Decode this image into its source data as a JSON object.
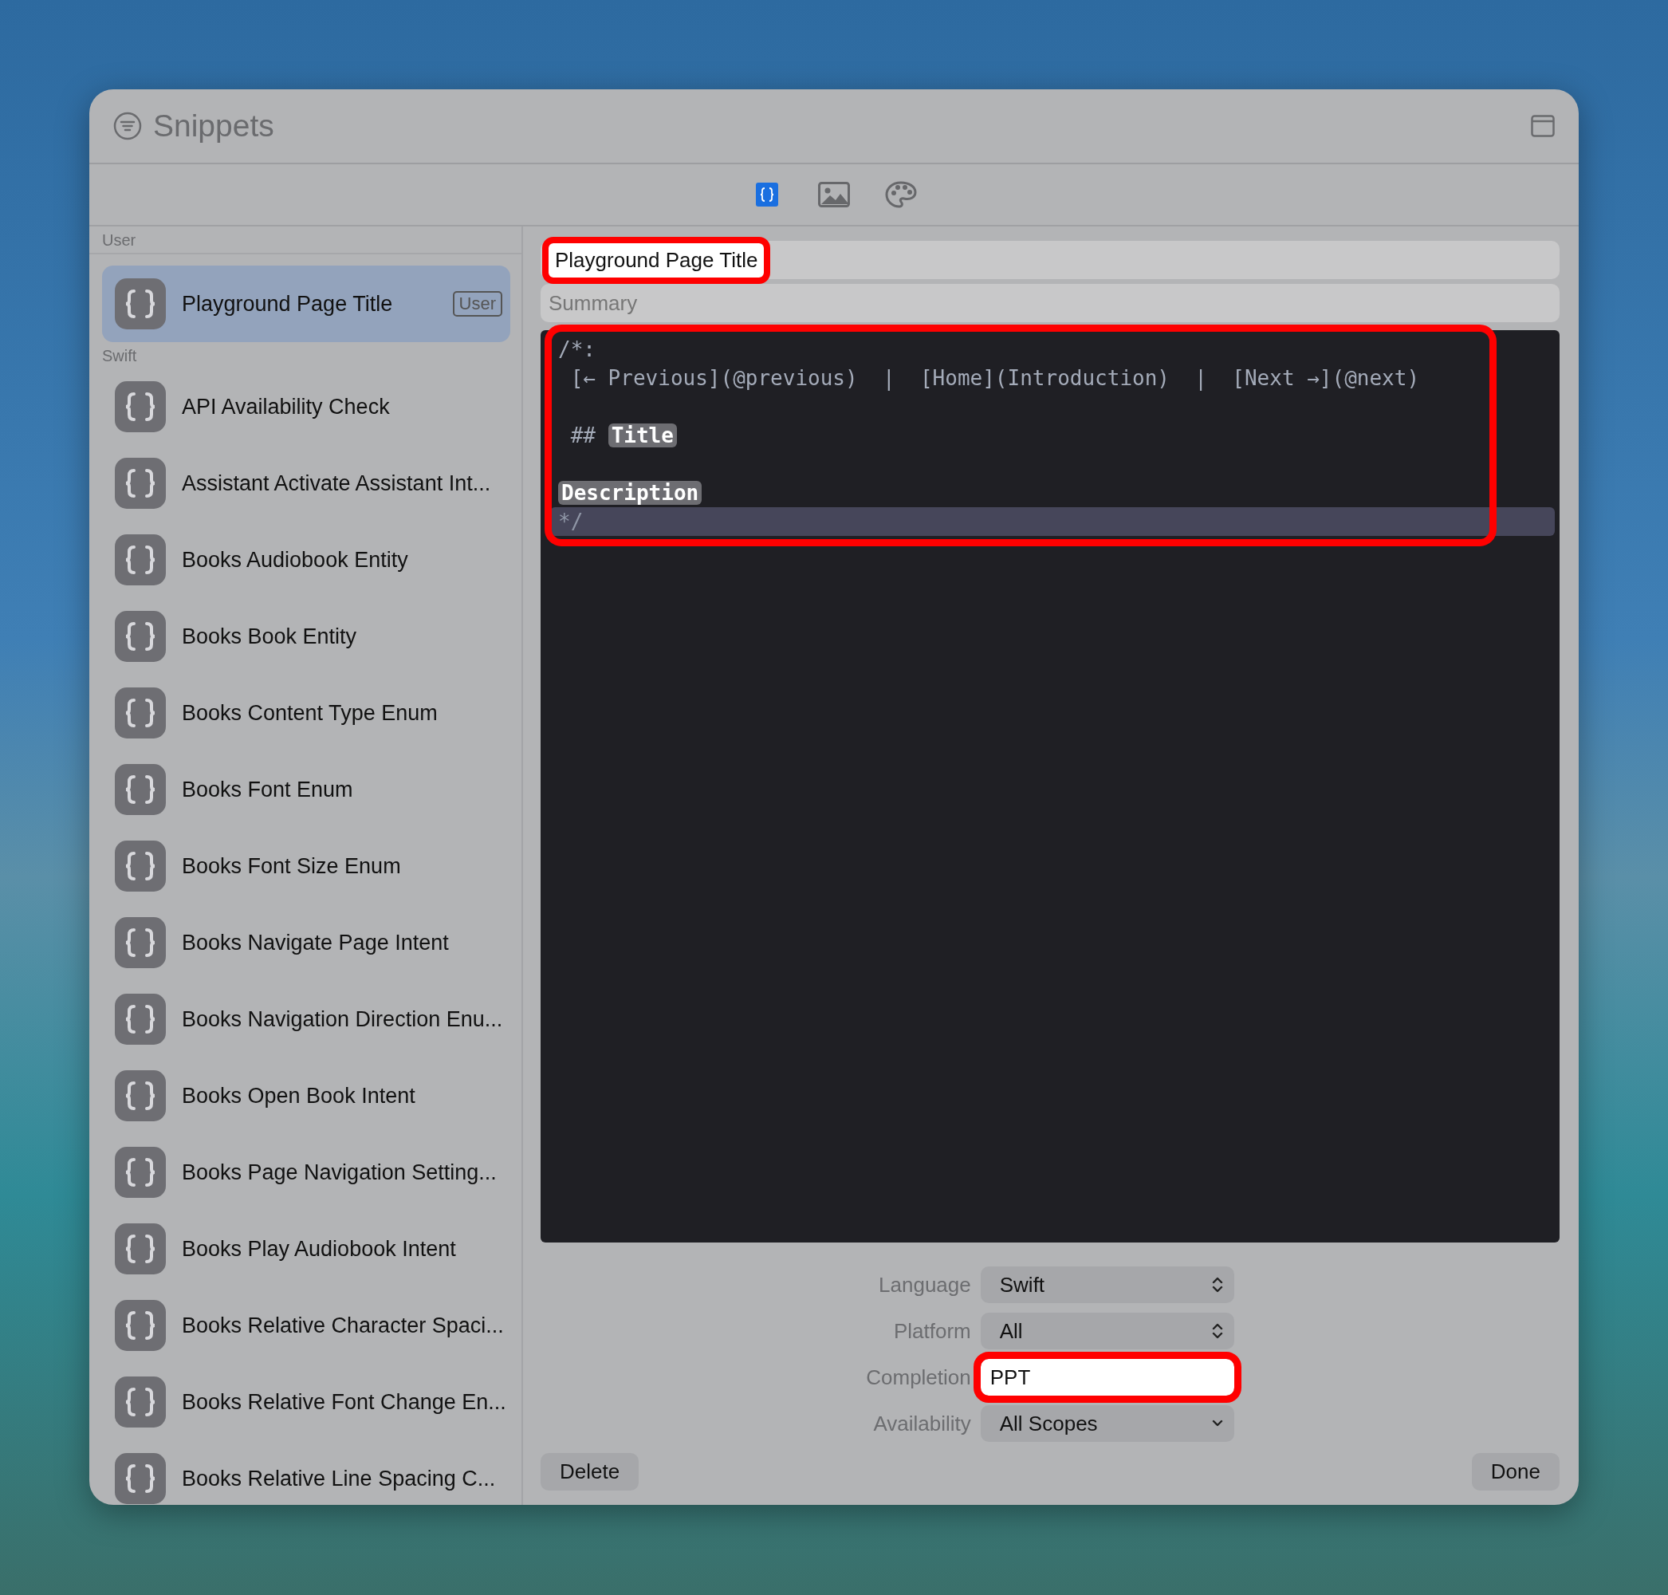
{
  "window": {
    "title": "Snippets"
  },
  "toolbar": {
    "tabs": [
      {
        "kind": "code",
        "selected": true
      },
      {
        "kind": "image",
        "selected": false
      },
      {
        "kind": "palette",
        "selected": false
      }
    ]
  },
  "sidebar": {
    "sections": [
      {
        "title": "User",
        "items": [
          {
            "label": "Playground Page Title",
            "badge": "User",
            "selected": true
          }
        ]
      },
      {
        "title": "Swift",
        "items": [
          {
            "label": "API Availability Check",
            "selected": false
          },
          {
            "label": "Assistant Activate Assistant Int...",
            "selected": false
          },
          {
            "label": "Books Audiobook Entity",
            "selected": false
          },
          {
            "label": "Books Book Entity",
            "selected": false
          },
          {
            "label": "Books Content Type Enum",
            "selected": false
          },
          {
            "label": "Books Font Enum",
            "selected": false
          },
          {
            "label": "Books Font Size Enum",
            "selected": false
          },
          {
            "label": "Books Navigate Page Intent",
            "selected": false
          },
          {
            "label": "Books Navigation Direction Enu...",
            "selected": false
          },
          {
            "label": "Books Open Book Intent",
            "selected": false
          },
          {
            "label": "Books Page Navigation Setting...",
            "selected": false
          },
          {
            "label": "Books Play Audiobook Intent",
            "selected": false
          },
          {
            "label": "Books Relative Character Spaci...",
            "selected": false
          },
          {
            "label": "Books Relative Font Change En...",
            "selected": false
          },
          {
            "label": "Books Relative Line Spacing C...",
            "selected": false
          }
        ]
      }
    ]
  },
  "editor": {
    "title_field": {
      "value": "Playground Page Title",
      "highlighted": true
    },
    "summary_field": {
      "placeholder": "Summary"
    },
    "code": {
      "highlighted": true,
      "lines": [
        {
          "current": false,
          "segments": [
            {
              "kind": "plain",
              "text": "/*:"
            }
          ]
        },
        {
          "current": false,
          "segments": [
            {
              "kind": "plain",
              "text": " [← Previous](@previous)  |  [Home](Introduction)  |  [Next →](@next)"
            }
          ]
        },
        {
          "current": false
        },
        {
          "current": false,
          "segments": [
            {
              "kind": "plain",
              "text": " ## "
            },
            {
              "kind": "token",
              "text": "Title"
            }
          ]
        },
        {
          "current": false
        },
        {
          "current": false,
          "segments": [
            {
              "kind": "token",
              "text": "Description"
            }
          ]
        },
        {
          "current": true,
          "segments": [
            {
              "kind": "plain",
              "text": "*/"
            }
          ]
        }
      ]
    },
    "settings": [
      {
        "kind": "popup",
        "label": "Language",
        "value": "Swift",
        "highlighted": false
      },
      {
        "kind": "popup",
        "label": "Platform",
        "value": "All",
        "highlighted": false
      },
      {
        "kind": "field",
        "label": "Completion",
        "value": "PPT",
        "highlighted": true
      },
      {
        "kind": "dropdown",
        "label": "Availability",
        "value": "All Scopes",
        "highlighted": false
      }
    ],
    "buttons": {
      "left": "Delete",
      "right": "Done"
    }
  }
}
